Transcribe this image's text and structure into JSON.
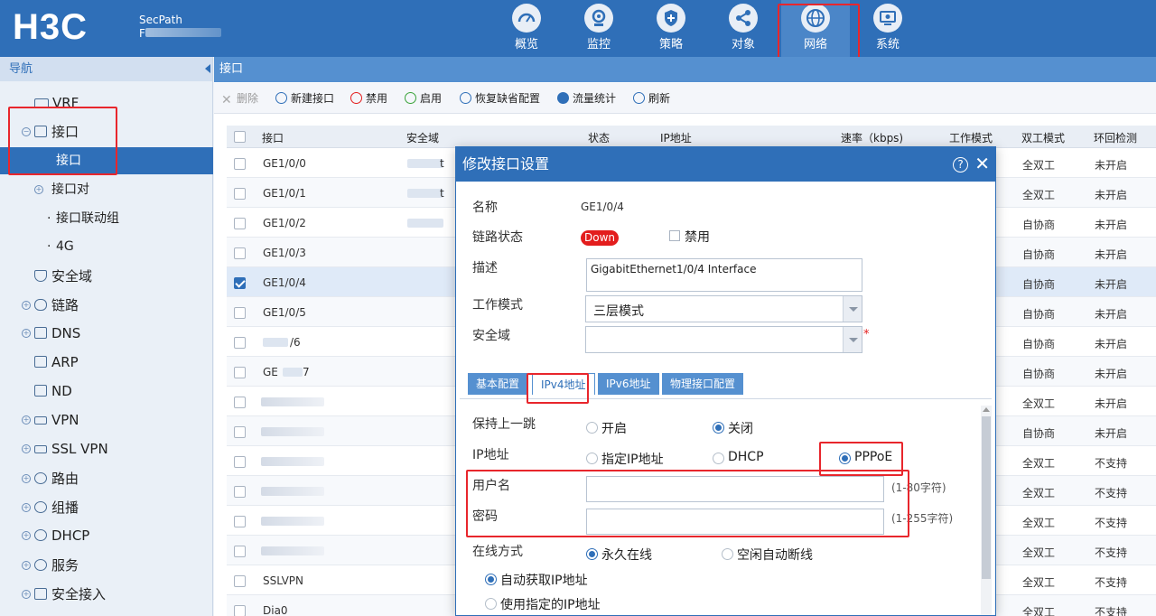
{
  "header": {
    "brand": "H3C",
    "product": "SecPath",
    "product_sub_visible": "F",
    "nav": [
      {
        "label": "概览",
        "icon": "dashboard-icon"
      },
      {
        "label": "监控",
        "icon": "monitor-icon"
      },
      {
        "label": "策略",
        "icon": "shield-icon"
      },
      {
        "label": "对象",
        "icon": "share-nodes-icon"
      },
      {
        "label": "网络",
        "icon": "globe-icon",
        "active": true
      },
      {
        "label": "系统",
        "icon": "system-icon"
      }
    ]
  },
  "sidebar": {
    "title": "导航",
    "items": [
      {
        "label": "VRF"
      },
      {
        "label": "接口",
        "expanded": true
      },
      {
        "label": "接口",
        "selected": true
      },
      {
        "label": "接口对"
      },
      {
        "label": "接口联动组"
      },
      {
        "label": "4G"
      },
      {
        "label": "安全域"
      },
      {
        "label": "链路"
      },
      {
        "label": "DNS"
      },
      {
        "label": "ARP"
      },
      {
        "label": "ND"
      },
      {
        "label": "VPN"
      },
      {
        "label": "SSL VPN"
      },
      {
        "label": "路由"
      },
      {
        "label": "组播"
      },
      {
        "label": "DHCP"
      },
      {
        "label": "服务"
      },
      {
        "label": "安全接入"
      }
    ]
  },
  "breadcrumb": "接口",
  "toolbar": {
    "delete": "删除",
    "new": "新建接口",
    "disable": "禁用",
    "enable": "启用",
    "restore": "恢复缺省配置",
    "stats": "流量统计",
    "refresh": "刷新"
  },
  "table": {
    "headers": [
      "接口",
      "安全域",
      "状态",
      "IP地址",
      "速率（kbps)",
      "工作模式",
      "双工模式",
      "环回检测"
    ],
    "rows": [
      {
        "name": "GE1/0/0",
        "zone_suffix": "t",
        "duplex": "全双工",
        "loop": "未开启"
      },
      {
        "name": "GE1/0/1",
        "zone_suffix": "t",
        "duplex": "全双工",
        "loop": "未开启"
      },
      {
        "name": "GE1/0/2",
        "zone_suffix": "",
        "duplex": "自协商",
        "loop": "未开启"
      },
      {
        "name": "GE1/0/3",
        "zone_suffix": "",
        "duplex": "自协商",
        "loop": "未开启"
      },
      {
        "name": "GE1/0/4",
        "zone_suffix": "",
        "duplex": "自协商",
        "loop": "未开启",
        "checked": true
      },
      {
        "name": "GE1/0/5",
        "zone_suffix": "",
        "duplex": "自协商",
        "loop": "未开启"
      },
      {
        "name": "",
        "name_tail": "/6",
        "zone_suffix": "",
        "duplex": "自协商",
        "loop": "未开启"
      },
      {
        "name": "GE",
        "name_tail": "7",
        "zone_suffix": "",
        "duplex": "自协商",
        "loop": "未开启"
      },
      {
        "name": "",
        "zone_suffix": "",
        "duplex": "全双工",
        "loop": "未开启"
      },
      {
        "name": "",
        "zone_suffix": "",
        "duplex": "自协商",
        "loop": "未开启"
      },
      {
        "name": "",
        "zone_suffix": "",
        "duplex": "全双工",
        "loop": "不支持"
      },
      {
        "name": "",
        "zone_suffix": "",
        "duplex": "全双工",
        "loop": "不支持"
      },
      {
        "name": "",
        "zone_suffix": "",
        "duplex": "全双工",
        "loop": "不支持"
      },
      {
        "name": "",
        "zone_suffix": "",
        "duplex": "全双工",
        "loop": "不支持"
      },
      {
        "name": "SSLVPN",
        "zone_suffix": "",
        "duplex": "全双工",
        "loop": "不支持"
      },
      {
        "name": "Dia0",
        "zone_suffix": "",
        "duplex": "全双工",
        "loop": "不支持"
      }
    ]
  },
  "dialog": {
    "title": "修改接口设置",
    "name_label": "名称",
    "name_value": "GE1/0/4",
    "link_label": "链路状态",
    "link_status": "Down",
    "disable_label": "禁用",
    "desc_label": "描述",
    "desc_value": "GigabitEthernet1/0/4 Interface",
    "mode_label": "工作模式",
    "mode_value": "三层模式",
    "zone_label": "安全域",
    "zone_value": "",
    "required_mark": "*",
    "tabs": [
      "基本配置",
      "IPv4地址",
      "IPv6地址",
      "物理接口配置"
    ],
    "active_tab": 1,
    "keep_hop_label": "保持上一跳",
    "keep_hop_on": "开启",
    "keep_hop_off": "关闭",
    "ip_label": "IP地址",
    "ip_opt_static": "指定IP地址",
    "ip_opt_dhcp": "DHCP",
    "ip_opt_pppoe": "PPPoE",
    "user_label": "用户名",
    "user_value": "",
    "user_hint": "(1-80字符)",
    "pwd_label": "密码",
    "pwd_value": "",
    "pwd_hint": "(1-255字符)",
    "online_label": "在线方式",
    "online_always": "永久在线",
    "online_idle": "空闲自动断线",
    "auto_ip": "自动获取IP地址",
    "fixed_ip": "使用指定的IP地址"
  }
}
